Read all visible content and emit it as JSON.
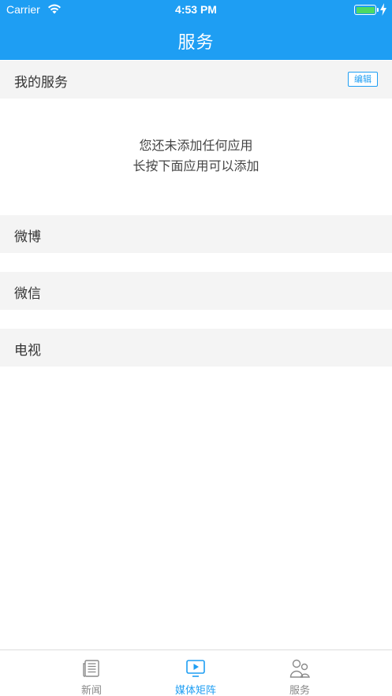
{
  "status_bar": {
    "carrier": "Carrier",
    "time": "4:53 PM"
  },
  "nav": {
    "title": "服务"
  },
  "my_services": {
    "title": "我的服务",
    "edit_label": "编辑"
  },
  "empty_state": {
    "line1": "您还未添加任何应用",
    "line2": "长按下面应用可以添加"
  },
  "categories": [
    "微博",
    "微信",
    "电视"
  ],
  "tabs": [
    {
      "label": "新闻",
      "icon": "newspaper-icon",
      "active": false
    },
    {
      "label": "媒体矩阵",
      "icon": "play-screen-icon",
      "active": true
    },
    {
      "label": "服务",
      "icon": "people-icon",
      "active": false
    }
  ],
  "colors": {
    "accent": "#1e9ef3",
    "section_bg": "#f4f4f4",
    "battery": "#4cd964"
  }
}
